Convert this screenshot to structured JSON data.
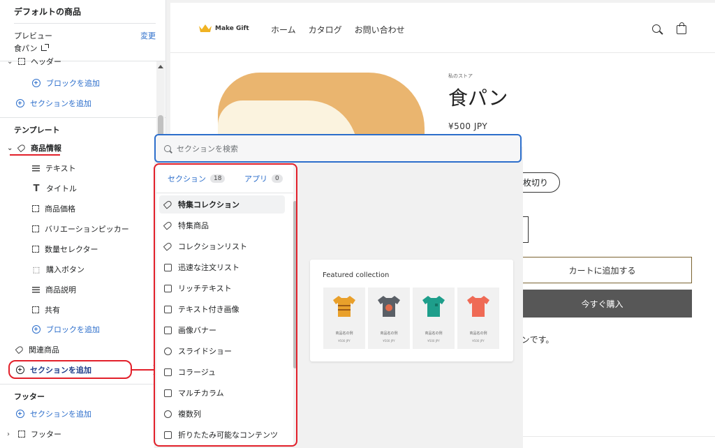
{
  "sidebar": {
    "title": "デフォルトの商品",
    "preview_label": "プレビュー",
    "change_label": "変更",
    "preview_value": "食パン",
    "header_item": "ヘッダー",
    "add_block": "ブロックを追加",
    "add_section": "セクションを追加",
    "template_heading": "テンプレート",
    "product_info": "商品情報",
    "blocks": [
      {
        "label": "テキスト",
        "icon": "lines-icon"
      },
      {
        "label": "タイトル",
        "icon": "title-icon"
      },
      {
        "label": "商品価格",
        "icon": "dotted-square-icon"
      },
      {
        "label": "バリエーションピッカー",
        "icon": "dotted-square-icon"
      },
      {
        "label": "数量セレクター",
        "icon": "dotted-square-icon"
      },
      {
        "label": "購入ボタン",
        "icon": "cursor-icon"
      },
      {
        "label": "商品説明",
        "icon": "lines-icon"
      },
      {
        "label": "共有",
        "icon": "dotted-square-icon"
      }
    ],
    "related_products": "関連商品",
    "footer_heading": "フッター",
    "footer_item": "フッター"
  },
  "store": {
    "logo_text": "Make Gift",
    "nav": [
      "ホーム",
      "カタログ",
      "お問い合わせ"
    ],
    "store_name": "私のストア",
    "product_title": "食パン",
    "price": "¥500 JPY",
    "variant": "枚切り",
    "cart_button": "カートに追加する",
    "buy_button": "今すぐ購入",
    "description": "パンです。"
  },
  "picker": {
    "search_placeholder": "セクションを検索",
    "tab_sections": "セクション",
    "tab_sections_count": "18",
    "tab_apps": "アプリ",
    "tab_apps_count": "0",
    "items": [
      {
        "label": "特集コレクション",
        "icon": "collection-icon"
      },
      {
        "label": "特集商品",
        "icon": "tag-icon"
      },
      {
        "label": "コレクションリスト",
        "icon": "collection-icon"
      },
      {
        "label": "迅速な注文リスト",
        "icon": "list-icon"
      },
      {
        "label": "リッチテキスト",
        "icon": "text-icon"
      },
      {
        "label": "テキスト付き画像",
        "icon": "image-icon"
      },
      {
        "label": "画像バナー",
        "icon": "image-icon"
      },
      {
        "label": "スライドショー",
        "icon": "slideshow-icon"
      },
      {
        "label": "コラージュ",
        "icon": "collage-icon"
      },
      {
        "label": "マルチカラム",
        "icon": "columns-icon"
      },
      {
        "label": "複数列",
        "icon": "rows-icon"
      },
      {
        "label": "折りたたみ可能なコンテンツ",
        "icon": "collapsible-icon"
      }
    ]
  },
  "featured_card": {
    "title": "Featured collection",
    "products": [
      {
        "name": "商品名の例",
        "price": "¥500 JPY",
        "color": "#e9a02b"
      },
      {
        "name": "商品名の例",
        "price": "¥500 JPY",
        "color": "#5a5f66"
      },
      {
        "name": "商品名の例",
        "price": "¥500 JPY",
        "color": "#1e9e8b"
      },
      {
        "name": "商品名の例",
        "price": "¥500 JPY",
        "color": "#ef6a55"
      }
    ]
  },
  "colors": {
    "accent": "#2c6ecb",
    "annotation_red": "#e2202a"
  }
}
